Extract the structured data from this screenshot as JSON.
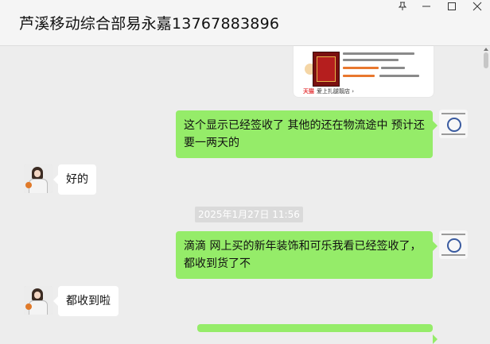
{
  "window": {
    "title": "芦溪移动综合部易永嘉13767883896",
    "pin_icon": "pin-icon",
    "min_icon": "minimize-icon",
    "max_icon": "maximize-icon",
    "close_icon": "close-icon"
  },
  "product_card": {
    "store_tag": "天猫",
    "store_name": "爱上扎腿靓店 ›"
  },
  "messages": [
    {
      "side": "right",
      "text": "这个显示已经签收了 其他的还在物流途中 预计还要一两天的"
    },
    {
      "side": "left",
      "text": "好的"
    },
    {
      "side": "right",
      "text": "滴滴  网上买的新年装饰和可乐我看已经签收了，都收到货了不"
    },
    {
      "side": "left",
      "text": "都收到啦"
    }
  ],
  "timestamp": "2025年1月27日 11:56",
  "colors": {
    "self_bubble": "#95ec69",
    "other_bubble": "#ffffff",
    "chat_background": "#ededed"
  }
}
